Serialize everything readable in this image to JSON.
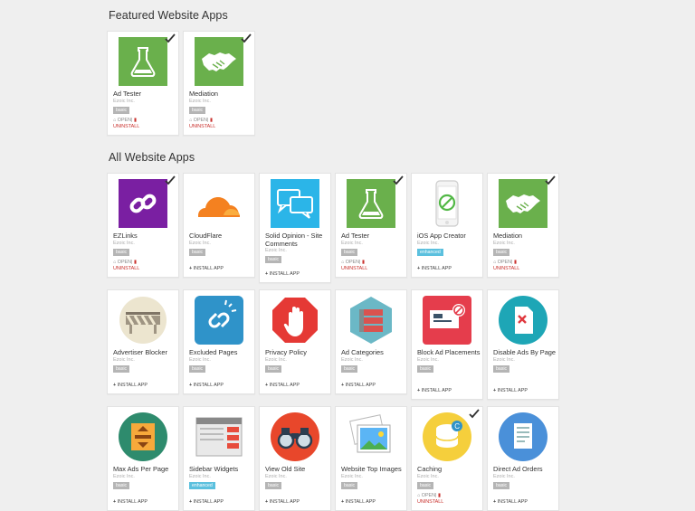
{
  "featured": {
    "title": "Featured Website Apps",
    "apps": [
      {
        "name": "Ad Tester",
        "company": "Ezoic Inc.",
        "tier": "basic",
        "open": "OPEN",
        "sep": "|",
        "uninstall": "UNINSTALL",
        "icon": "flask-icon",
        "installed": true
      },
      {
        "name": "Mediation",
        "company": "Ezoic Inc.",
        "tier": "basic",
        "open": "OPEN",
        "sep": "|",
        "uninstall": "UNINSTALL",
        "icon": "handshake-icon",
        "installed": true
      }
    ]
  },
  "all": {
    "title": "All Website Apps",
    "apps": [
      {
        "name": "EZLinks",
        "company": "Ezoic Inc.",
        "tier": "basic",
        "open": "OPEN",
        "sep": "|",
        "uninstall": "UNINSTALL",
        "icon": "link-icon",
        "installed": true
      },
      {
        "name": "CloudFlare",
        "company": "Ezoic Inc.",
        "tier": "basic",
        "install": "INSTALL APP",
        "icon": "cloud-icon",
        "installed": false
      },
      {
        "name": "Solid Opinion - Site Comments",
        "company": "Ezoic Inc.",
        "tier": "basic",
        "install": "INSTALL APP",
        "icon": "chat-bubbles-icon",
        "installed": false
      },
      {
        "name": "Ad Tester",
        "company": "Ezoic Inc.",
        "tier": "basic",
        "open": "OPEN",
        "sep": "|",
        "uninstall": "UNINSTALL",
        "icon": "flask-icon",
        "installed": true
      },
      {
        "name": "iOS App Creator",
        "company": "Ezoic Inc.",
        "tier": "enhanced",
        "install": "INSTALL APP",
        "icon": "phone-icon",
        "installed": false
      },
      {
        "name": "Mediation",
        "company": "Ezoic Inc.",
        "tier": "basic",
        "open": "OPEN",
        "sep": "|",
        "uninstall": "UNINSTALL",
        "icon": "handshake-icon",
        "installed": true
      },
      {
        "name": "Advertiser Blocker",
        "company": "Ezoic Inc.",
        "tier": "basic",
        "install": "INSTALL APP",
        "icon": "barricade-icon",
        "installed": false
      },
      {
        "name": "Excluded Pages",
        "company": "Ezoic Inc.",
        "tier": "basic",
        "install": "INSTALL APP",
        "icon": "broken-link-icon",
        "installed": false
      },
      {
        "name": "Privacy Policy",
        "company": "Ezoic Inc.",
        "tier": "basic",
        "install": "INSTALL APP",
        "icon": "stop-hand-icon",
        "installed": false
      },
      {
        "name": "Ad Categories",
        "company": "Ezoic Inc.",
        "tier": "basic",
        "install": "INSTALL APP",
        "icon": "categories-icon",
        "installed": false
      },
      {
        "name": "Block Ad Placements",
        "company": "Ezoic Inc.",
        "tier": "basic",
        "install": "INSTALL APP",
        "icon": "block-placement-icon",
        "installed": false
      },
      {
        "name": "Disable Ads By Page",
        "company": "Ezoic Inc.",
        "tier": "basic",
        "install": "INSTALL APP",
        "icon": "disable-page-icon",
        "installed": false
      },
      {
        "name": "Max Ads Per Page",
        "company": "Ezoic Inc.",
        "tier": "basic",
        "install": "INSTALL APP",
        "icon": "max-ads-icon",
        "installed": false
      },
      {
        "name": "Sidebar Widgets",
        "company": "Ezoic Inc.",
        "tier": "enhanced",
        "install": "INSTALL APP",
        "icon": "sidebar-icon",
        "installed": false
      },
      {
        "name": "View Old Site",
        "company": "Ezoic Inc.",
        "tier": "basic",
        "install": "INSTALL APP",
        "icon": "binoculars-icon",
        "installed": false
      },
      {
        "name": "Website Top Images",
        "company": "Ezoic Inc.",
        "tier": "basic",
        "install": "INSTALL APP",
        "icon": "photos-icon",
        "installed": false
      },
      {
        "name": "Caching",
        "company": "Ezoic Inc.",
        "tier": "basic",
        "open": "OPEN",
        "sep": "|",
        "uninstall": "UNINSTALL",
        "icon": "database-icon",
        "installed": true
      },
      {
        "name": "Direct Ad Orders",
        "company": "Ezoic Inc.",
        "tier": "basic",
        "install": "INSTALL APP",
        "icon": "orders-icon",
        "installed": false
      }
    ]
  },
  "colors": {
    "green": "#6ab04c",
    "purple": "#7a1fa2",
    "blue": "#2f93c9",
    "red": "#e53935",
    "enhanced": "#5bc0de",
    "uninstall": "#c9302c"
  }
}
